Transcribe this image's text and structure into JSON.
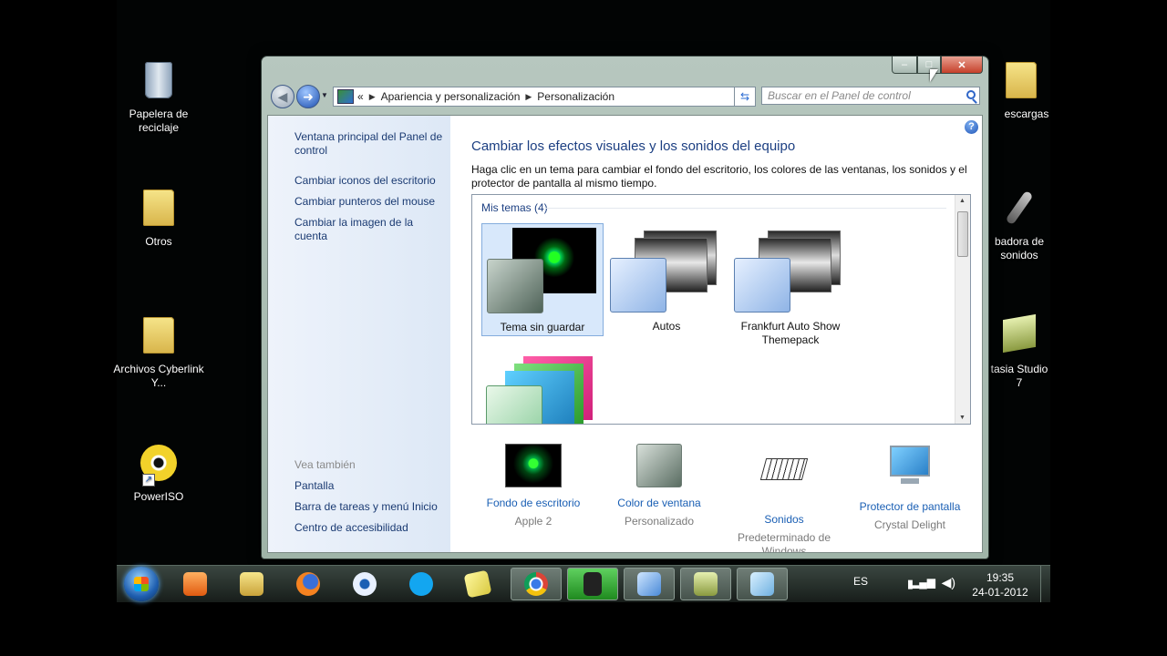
{
  "desktop": {
    "left_icons": [
      {
        "label": "Papelera de reciclaje",
        "icon": "recycle-bin-icon"
      },
      {
        "label": "Otros",
        "icon": "folder-icon"
      },
      {
        "label": "Archivos Cyberlink Y...",
        "icon": "folder-icon"
      },
      {
        "label": "PowerISO",
        "icon": "poweriso-icon"
      }
    ],
    "right_icons": [
      {
        "label": "escargas",
        "icon": "folder-icon"
      },
      {
        "label": "badora de sonidos",
        "icon": "microphone-icon"
      },
      {
        "label": "tasia Studio 7",
        "icon": "camtasia-icon"
      }
    ]
  },
  "window": {
    "caption_buttons": {
      "minimize": "–",
      "maximize": "□",
      "close": "✕"
    },
    "address": {
      "overflow": "«",
      "crumb1": "Apariencia y personalización",
      "crumb2": "Personalización"
    },
    "search_placeholder": "Buscar en el Panel de control",
    "sidebar": {
      "main_link": "Ventana principal del Panel de control",
      "links": [
        "Cambiar iconos del escritorio",
        "Cambiar punteros del mouse",
        "Cambiar la imagen de la cuenta"
      ],
      "see_also_heading": "Vea también",
      "see_also": [
        "Pantalla",
        "Barra de tareas y menú Inicio",
        "Centro de accesibilidad"
      ]
    },
    "help": "?",
    "title": "Cambiar los efectos visuales y los sonidos del equipo",
    "description": "Haga clic en un tema para cambiar el fondo del escritorio, los colores de las ventanas, los sonidos y el protector de pantalla al mismo tiempo.",
    "themes_group": "Mis temas (4)",
    "themes": [
      {
        "name": "Tema sin guardar",
        "selected": true
      },
      {
        "name": "Autos",
        "selected": false
      },
      {
        "name": "Frankfurt Auto Show Themepack",
        "selected": false
      },
      {
        "name": "",
        "selected": false
      }
    ],
    "bottom": [
      {
        "link": "Fondo de escritorio",
        "value": "Apple 2",
        "icon": "desktop-background-icon"
      },
      {
        "link": "Color de ventana",
        "value": "Personalizado",
        "icon": "window-color-icon"
      },
      {
        "link": "Sonidos",
        "value": "Predeterminado de Windows",
        "icon": "sounds-icon"
      },
      {
        "link": "Protector de pantalla",
        "value": "Crystal Delight",
        "icon": "screensaver-icon"
      }
    ]
  },
  "taskbar": {
    "language": "ES",
    "time": "19:35",
    "date": "24-01-2012",
    "items": [
      "media-player-icon",
      "explorer-icon",
      "firefox-icon",
      "itunes-icon",
      "skype-icon",
      "sticky-notes-icon",
      "chrome-icon",
      "camtasia-recorder-icon",
      "control-panel-icon",
      "camtasia-studio-icon",
      "notepad-icon"
    ],
    "colors": {
      "accent": "#1a5fb4",
      "title": "#1c3f82"
    }
  }
}
